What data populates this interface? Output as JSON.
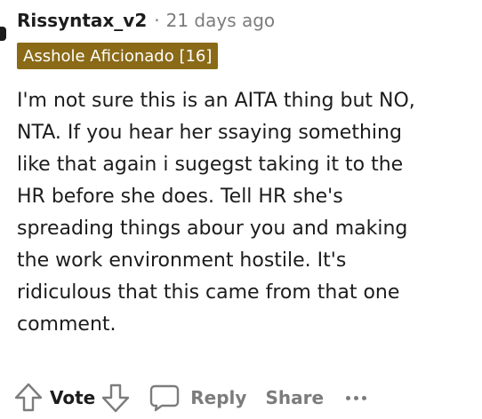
{
  "comment": {
    "author": "Rissyntax_v2",
    "separator": "·",
    "timestamp": "21 days ago",
    "flair": "Asshole Aficionado [16]",
    "body_lines": [
      "I'm not sure this is an AITA thing but NO,",
      "NTA. If you hear her ssaying something",
      "like that again i sugegst taking it to the",
      "HR before she does. Tell HR she's",
      "spreading things abour you and making",
      "the work environment hostile. It's",
      "ridiculous that this came from that one",
      "comment."
    ]
  },
  "actions": {
    "upvote_icon": "arrow-up-icon",
    "vote_label": "Vote",
    "downvote_icon": "arrow-down-icon",
    "reply_icon": "speech-bubble-icon",
    "reply_label": "Reply",
    "share_label": "Share",
    "more_icon": "more-dots-icon"
  },
  "colors": {
    "flair_background": "#8a6a17",
    "muted_text": "#7c7c7c",
    "primary_text": "#1c1c1c"
  }
}
